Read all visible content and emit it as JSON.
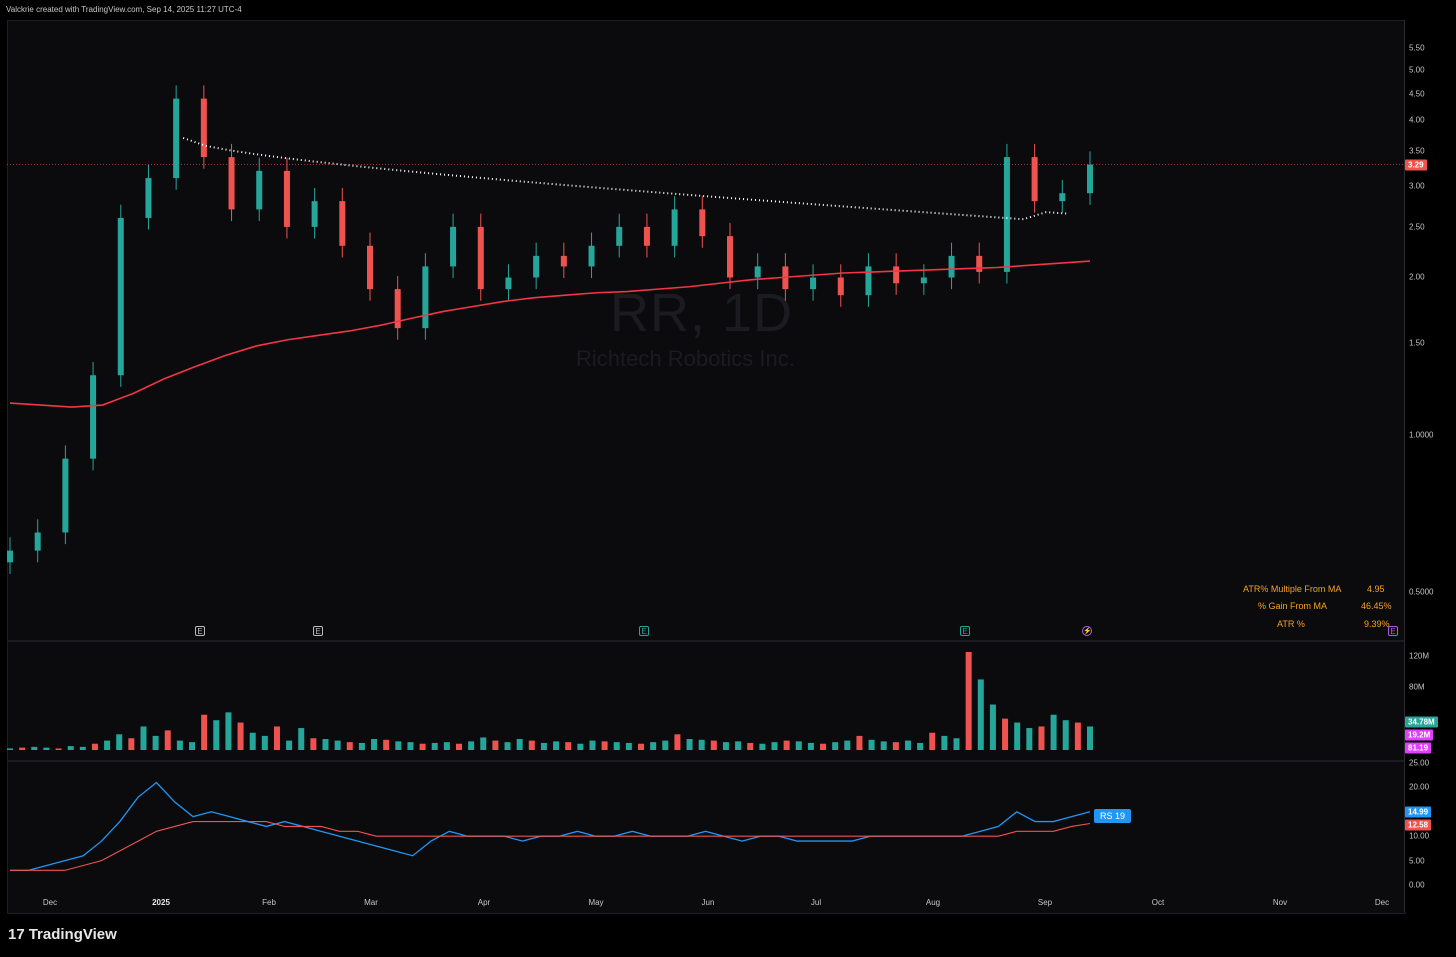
{
  "header": {
    "text": "Valckrie created with TradingView.com, Sep 14, 2025 11:27 UTC-4"
  },
  "watermark": {
    "ticker": "RR, 1D",
    "company": "Richtech Robotics Inc."
  },
  "footer": {
    "logo_mark": "17",
    "logo_text": "TradingView"
  },
  "stats": {
    "labels": [
      "ATR% Multiple From MA",
      "% Gain From MA",
      "ATR %"
    ],
    "values": [
      "4.95",
      "46.45%",
      "9.39%"
    ]
  },
  "earnings_markers": [
    "E",
    "E",
    "E",
    "E",
    "E"
  ],
  "colors": {
    "up": "#26a69a",
    "down": "#ef5350",
    "ema_fast": "#26c46a",
    "ema_mid": "#3f51e8",
    "ema_slow": "#c5c44a",
    "sma_long": "#f23645",
    "vwap": "#ffffff",
    "rs": "#2196f3",
    "rs_ma": "#e040fb",
    "atr_text": "#f7a21b"
  },
  "chart_data": [
    {
      "type": "line",
      "title": "RR, 1D",
      "subtitle": "Richtech Robotics Inc.",
      "x": [
        "Dec",
        "2025",
        "Feb",
        "Mar",
        "Apr",
        "May",
        "Jun",
        "Jul",
        "Aug",
        "Sep",
        "Oct",
        "Nov",
        "Dec"
      ],
      "series": [
        {
          "values": [
            0.6,
            0.65,
            0.9,
            1.3,
            2.6,
            3.1,
            4.4,
            3.4,
            2.7,
            3.2,
            2.5,
            2.8,
            2.3,
            1.9,
            1.6,
            2.1,
            2.5,
            1.9,
            2.0,
            2.2,
            2.1,
            2.3,
            2.5,
            2.3,
            2.7,
            2.4,
            2.0,
            2.1,
            1.9,
            2.0,
            1.85,
            2.1,
            1.95,
            2.0,
            2.2,
            2.05,
            3.4,
            2.8,
            2.9,
            3.29
          ]
        },
        {
          "values": [
            1.15,
            1.14,
            1.13,
            1.14,
            1.2,
            1.28,
            1.35,
            1.42,
            1.48,
            1.52,
            1.55,
            1.58,
            1.62,
            1.67,
            1.72,
            1.76,
            1.8,
            1.83,
            1.85,
            1.87,
            1.88,
            1.9,
            1.92,
            1.95,
            1.98,
            2.0,
            2.02,
            2.04,
            2.05,
            2.06,
            2.07,
            2.08,
            2.09,
            2.11,
            2.13,
            2.15
          ]
        }
      ],
      "y_ticks": [
        "5.50",
        "5.00",
        "4.50",
        "4.00",
        "3.50",
        "3.00",
        "2.50",
        "2.00",
        "1.50",
        "1.0000",
        "0.5000"
      ],
      "last_price": "3.29"
    },
    {
      "type": "bar",
      "y_ticks": [
        "120M",
        "80M"
      ],
      "values": [
        2,
        3,
        4,
        3,
        2,
        5,
        4,
        8,
        12,
        20,
        15,
        30,
        18,
        25,
        12,
        10,
        45,
        38,
        48,
        35,
        22,
        18,
        30,
        12,
        28,
        15,
        14,
        12,
        10,
        9,
        14,
        13,
        11,
        10,
        8,
        9,
        10,
        8,
        11,
        16,
        12,
        10,
        14,
        12,
        9,
        11,
        10,
        8,
        12,
        11,
        10,
        9,
        8,
        10,
        12,
        20,
        14,
        13,
        12,
        10,
        11,
        9,
        8,
        10,
        12,
        11,
        9,
        8,
        10,
        12,
        18,
        13,
        11,
        10,
        12,
        9,
        22,
        18,
        15,
        125,
        90,
        58,
        40,
        35,
        28,
        30,
        45,
        38,
        35,
        30
      ],
      "labels": [
        "34.78M",
        "19.2M",
        "81.19"
      ]
    },
    {
      "type": "line",
      "y_ticks": [
        "25.00",
        "20.00",
        "15.00",
        "10.00",
        "5.00",
        "0.00"
      ],
      "series": [
        {
          "name": "RS 19",
          "values": [
            3,
            3,
            4,
            5,
            6,
            9,
            13,
            18,
            21,
            17,
            14,
            15,
            14,
            13,
            12,
            13,
            12,
            11,
            10,
            9,
            8,
            7,
            6,
            9,
            11,
            10,
            10,
            10,
            9,
            10,
            10,
            11,
            10,
            10,
            11,
            10,
            10,
            10,
            11,
            10,
            9,
            10,
            10,
            9,
            9,
            9,
            9,
            10,
            10,
            10,
            10,
            10,
            10,
            11,
            12,
            15,
            13,
            13,
            14,
            15
          ]
        },
        {
          "values": [
            3,
            3,
            3,
            3,
            4,
            5,
            7,
            9,
            11,
            12,
            13,
            13,
            13,
            13,
            13,
            12,
            12,
            12,
            11,
            11,
            10,
            10,
            10,
            10,
            10,
            10,
            10,
            10,
            10,
            10,
            10,
            10,
            10,
            10,
            10,
            10,
            10,
            10,
            10,
            10,
            10,
            10,
            10,
            10,
            10,
            10,
            10,
            10,
            10,
            10,
            10,
            10,
            10,
            10,
            10,
            11,
            11,
            11,
            12,
            12.6
          ]
        }
      ],
      "labels": [
        "14.99",
        "12.58"
      ]
    }
  ]
}
